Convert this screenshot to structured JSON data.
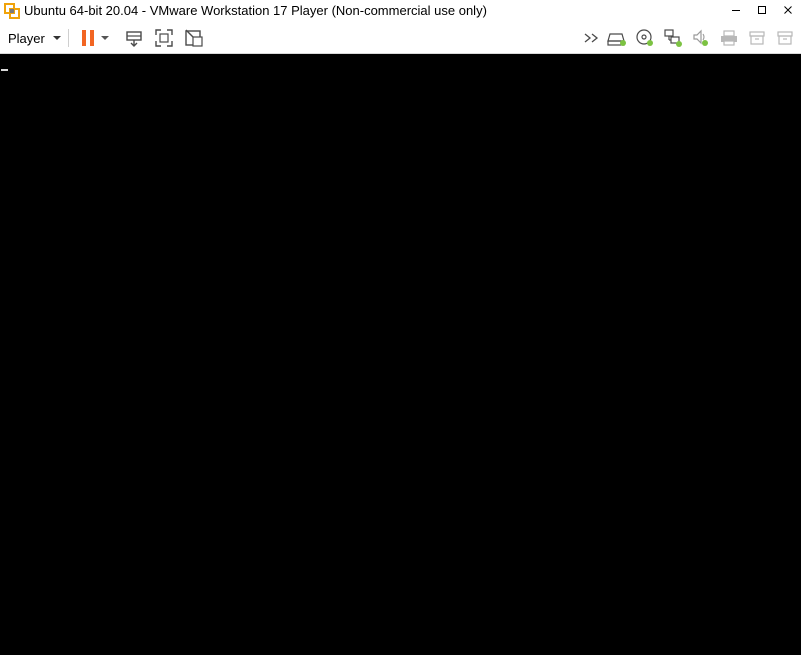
{
  "window": {
    "title": "Ubuntu 64-bit 20.04 - VMware Workstation 17 Player (Non-commercial use only)",
    "controls": {
      "minimize": "minimize-icon",
      "maximize": "maximize-icon",
      "close": "close-icon"
    }
  },
  "toolbar": {
    "player_label": "Player",
    "left_icons": [
      "pause-icon",
      "dropdown-caret-icon",
      "send-ctrl-alt-del-icon",
      "full-screen-icon",
      "unity-icon"
    ],
    "right_icons": [
      "expand-devices-icon",
      "hard-disk-icon",
      "cd-dvd-icon",
      "network-adapter-icon",
      "sound-card-icon",
      "printer-icon",
      "usb-icon-1",
      "usb-icon-2"
    ]
  },
  "colors": {
    "pause_accent": "#f26522",
    "status_green": "#7cc242",
    "console_bg": "#000000",
    "icon_gray": "#4a4a4a",
    "icon_disabled": "#b8b8b8"
  }
}
